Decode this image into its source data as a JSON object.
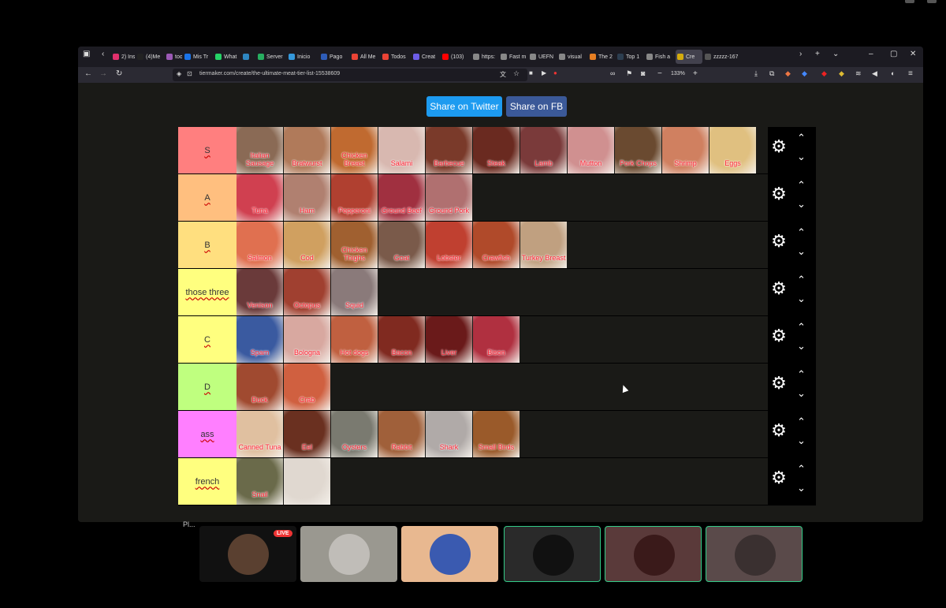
{
  "browser": {
    "tabs": [
      {
        "label": "2) Ins",
        "color": "#e1306c"
      },
      {
        "label": "(4)Me",
        "color": "#222"
      },
      {
        "label": "tools",
        "color": "#9b59b6"
      },
      {
        "label": "Mis Tr",
        "color": "#1a73e8"
      },
      {
        "label": "What",
        "color": "#25d366"
      },
      {
        "label": "",
        "color": "#2e86c1"
      },
      {
        "label": "Server",
        "color": "#27ae60"
      },
      {
        "label": "Inicio",
        "color": "#3498db"
      },
      {
        "label": "Pago",
        "color": "#2e5cb8"
      },
      {
        "label": "All Me",
        "color": "#ea4335"
      },
      {
        "label": "Todos",
        "color": "#ea4335"
      },
      {
        "label": "Creat",
        "color": "#6c5ce7"
      },
      {
        "label": "(103)",
        "color": "#ff0000"
      },
      {
        "label": "https:",
        "color": "#888"
      },
      {
        "label": "Fast m",
        "color": "#888"
      },
      {
        "label": "UEFN",
        "color": "#888"
      },
      {
        "label": "visual",
        "color": "#888"
      },
      {
        "label": "The 2",
        "color": "#e67e22"
      },
      {
        "label": "Top 1",
        "color": "#2c3e50"
      },
      {
        "label": "Fish a",
        "color": "#888"
      },
      {
        "label": "Cre",
        "color": "#d4ac0d",
        "active": true
      },
      {
        "label": "zzzzz-167",
        "color": "#555"
      }
    ],
    "url": "tiermaker.com/create/the-ultimate-meat-tier-list-15538609",
    "zoom": "133%"
  },
  "share": {
    "twitter": "Share on Twitter",
    "fb": "Share on FB"
  },
  "tiers": [
    {
      "label": "S",
      "color": "#ff7f7f",
      "items": [
        {
          "name": "Italian Sausage",
          "bg": "#8a6a55"
        },
        {
          "name": "Bratwurst",
          "bg": "#b07a5a"
        },
        {
          "name": "Chicken Breast",
          "bg": "#c06a30"
        },
        {
          "name": "Salami",
          "bg": "#d8b8b0"
        },
        {
          "name": "Barbecue",
          "bg": "#7a3a2a"
        },
        {
          "name": "Steak",
          "bg": "#6a2a20"
        },
        {
          "name": "Lamb",
          "bg": "#7a3a3a"
        },
        {
          "name": "Mutton",
          "bg": "#d09090"
        },
        {
          "name": "Pork Chops",
          "bg": "#6a4a30"
        },
        {
          "name": "Shrimp",
          "bg": "#d08060"
        },
        {
          "name": "Eggs",
          "bg": "#e0c080"
        }
      ]
    },
    {
      "label": "A",
      "color": "#ffbf7f",
      "items": [
        {
          "name": "Tuna",
          "bg": "#d04050"
        },
        {
          "name": "Ham",
          "bg": "#b08070"
        },
        {
          "name": "Pepperoni",
          "bg": "#b04030"
        },
        {
          "name": "Ground Beef",
          "bg": "#a03040"
        },
        {
          "name": "Ground Pork",
          "bg": "#b07070"
        }
      ]
    },
    {
      "label": "B",
      "color": "#ffdf7f",
      "items": [
        {
          "name": "Salmon",
          "bg": "#e07050"
        },
        {
          "name": "Cod",
          "bg": "#d0a060"
        },
        {
          "name": "Chicken Thighs",
          "bg": "#a06030"
        },
        {
          "name": "Goat",
          "bg": "#7a5a4a"
        },
        {
          "name": "Lobster",
          "bg": "#c04030"
        },
        {
          "name": "Crawfish",
          "bg": "#b04a2a"
        },
        {
          "name": "Turkey Breast",
          "bg": "#c0a080"
        }
      ]
    },
    {
      "label": "those three",
      "color": "#ffff7f",
      "items": [
        {
          "name": "Venison",
          "bg": "#6a3a3a"
        },
        {
          "name": "Octopus",
          "bg": "#a04030"
        },
        {
          "name": "Squid",
          "bg": "#8a7a7a"
        }
      ]
    },
    {
      "label": "C",
      "color": "#ffff7f",
      "items": [
        {
          "name": "Spam",
          "bg": "#3a5aa0"
        },
        {
          "name": "Bologna",
          "bg": "#d8a8a0"
        },
        {
          "name": "Hot dogs",
          "bg": "#c06040"
        },
        {
          "name": "Bacon",
          "bg": "#802a20"
        },
        {
          "name": "Liver",
          "bg": "#6a1a1a"
        },
        {
          "name": "Bison",
          "bg": "#b03040"
        }
      ]
    },
    {
      "label": "D",
      "color": "#bfff7f",
      "items": [
        {
          "name": "Duck",
          "bg": "#a04a30"
        },
        {
          "name": "Crab",
          "bg": "#d06040"
        }
      ]
    },
    {
      "label": "ass",
      "color": "#ff7fff",
      "items": [
        {
          "name": "Canned Tuna",
          "bg": "#e0c0a0"
        },
        {
          "name": "Eel",
          "bg": "#6a3020"
        },
        {
          "name": "Oysters",
          "bg": "#7a7a70"
        },
        {
          "name": "Rabbit",
          "bg": "#a0603a"
        },
        {
          "name": "Shark",
          "bg": "#b0aaa8"
        },
        {
          "name": "Small Birds",
          "bg": "#9a5a2a"
        }
      ]
    },
    {
      "label": "french",
      "color": "#ffff7f",
      "items": [
        {
          "name": "Snail",
          "bg": "#6a6a4a"
        },
        {
          "name": "",
          "bg": "#e0d8d0"
        }
      ]
    }
  ],
  "participants": [
    {
      "bg": "#111111",
      "avatar": "#5a4030",
      "live": "LIVE"
    },
    {
      "bg": "#9a9890",
      "avatar": "#c0bdb8"
    },
    {
      "bg": "#e8b890",
      "avatar": "#3a5ab0"
    },
    {
      "bg": "#2a2a2a",
      "avatar": "#111"
    },
    {
      "bg": "#5a3a3a",
      "avatar": "#3a1a1a"
    },
    {
      "bg": "#5a4a4a",
      "avatar": "#3a3030"
    }
  ],
  "footer_text": "Pl..."
}
